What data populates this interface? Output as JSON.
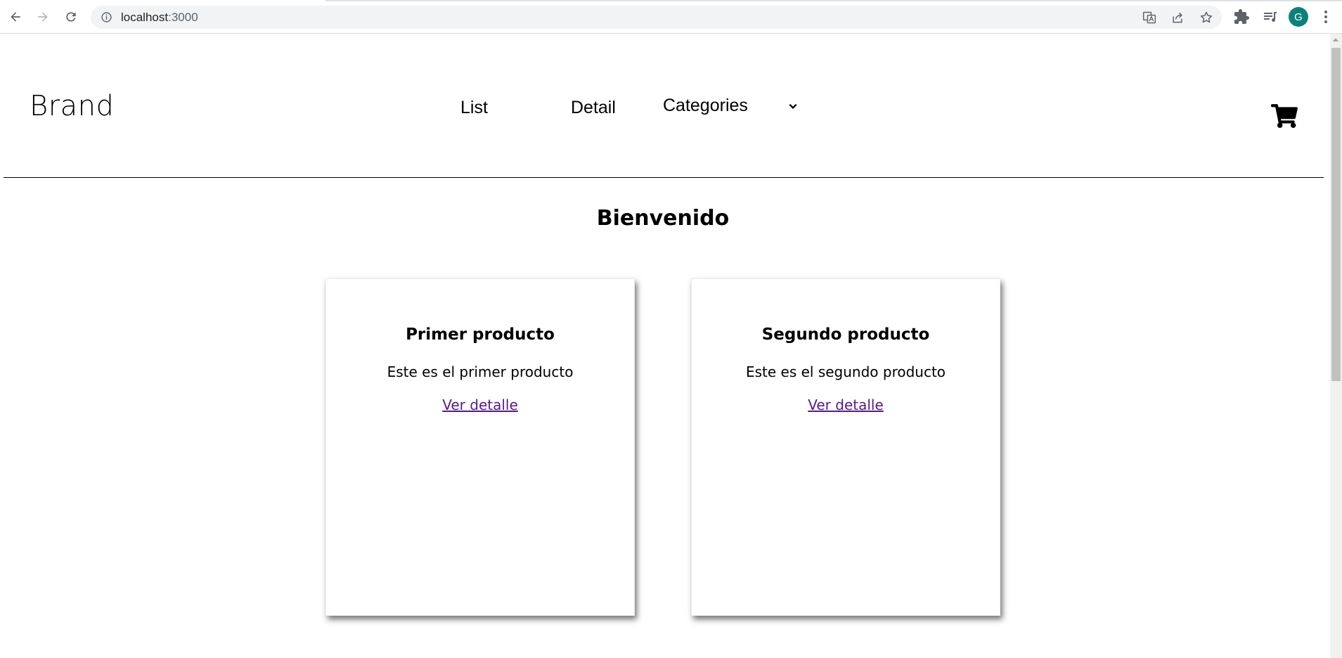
{
  "browser": {
    "url_host": "localhost",
    "url_port": ":3000",
    "profile_initial": "G",
    "accent": "#0b8279",
    "icons": [
      "back-icon",
      "forward-icon",
      "reload-icon",
      "site-info-icon",
      "translate-icon",
      "share-icon",
      "bookmark-star-icon",
      "extensions-icon",
      "media-icon",
      "more-menu-icon"
    ]
  },
  "header": {
    "brand": "Brand",
    "nav": {
      "list": "List",
      "detail": "Detail",
      "categories": "Categories"
    },
    "cart_icon": "cart-icon"
  },
  "main": {
    "heading": "Bienvenido",
    "products": [
      {
        "title": "Primer producto",
        "description": "Este es el primer producto",
        "link": "Ver detalle"
      },
      {
        "title": "Segundo producto",
        "description": "Este es el segundo producto",
        "link": "Ver detalle"
      }
    ],
    "link_color": "#551a8b"
  }
}
